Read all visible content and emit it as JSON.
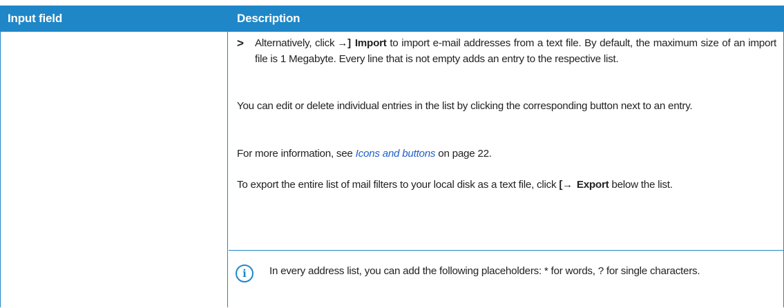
{
  "table": {
    "headers": {
      "input_field": "Input field",
      "description": "Description"
    }
  },
  "step": {
    "marker": ">",
    "pre": "Alternatively, click",
    "icon": "import-icon",
    "label": "Import",
    "post": "to import e-mail addresses from a text file. By default, the maximum size of an import file is 1 Megabyte. Every line that is not empty adds an entry to the respective list."
  },
  "edit_para": "You can edit or delete individual entries in the list by clicking the corresponding button next to an entry.",
  "info_para": {
    "pre": "For more information, see",
    "link": "Icons and buttons",
    "post": "on page 22."
  },
  "export_para": {
    "pre": "To export the entire list of mail filters to your local disk as a text file, click",
    "icon": "export-icon",
    "label": "Export",
    "post": "below the list."
  },
  "note": {
    "icon": "info-icon",
    "text": "In every address list, you can add the following placeholders: * for words, ? for single characters."
  },
  "colors": {
    "accent": "#1f87c8",
    "link": "#1f5fc8",
    "text": "#222222"
  }
}
